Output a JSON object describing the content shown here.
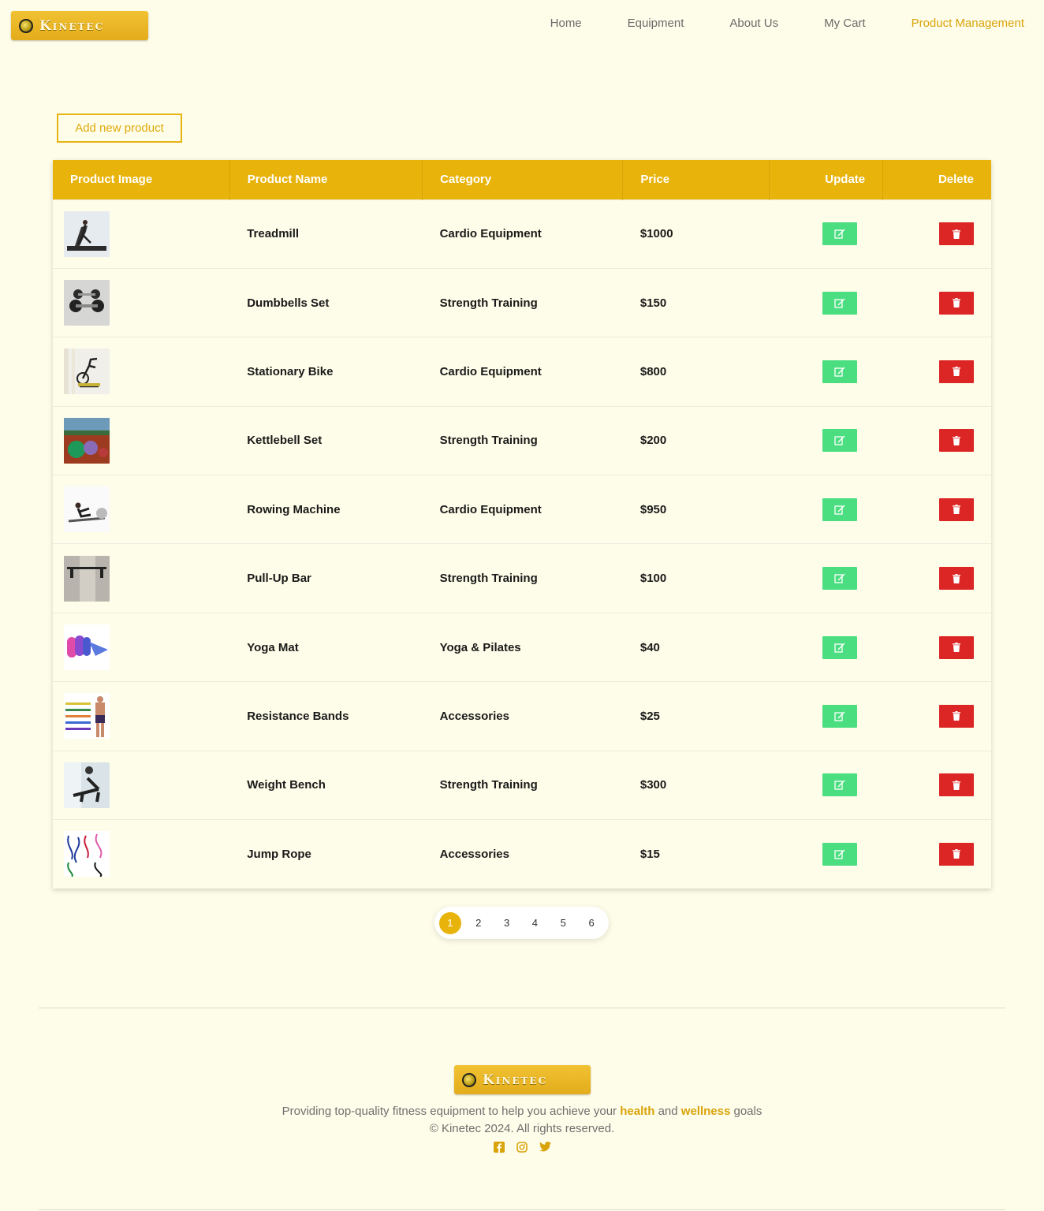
{
  "header": {
    "logo_text": "Kinetec",
    "nav": [
      {
        "label": "Home",
        "active": false
      },
      {
        "label": "Equipment",
        "active": false
      },
      {
        "label": "About Us",
        "active": false
      },
      {
        "label": "My Cart",
        "active": false
      },
      {
        "label": "Product Management",
        "active": true
      }
    ]
  },
  "add_button_label": "Add new product",
  "table": {
    "columns": [
      "Product Image",
      "Product Name",
      "Category",
      "Price",
      "Update",
      "Delete"
    ],
    "rows": [
      {
        "name": "Treadmill",
        "category": "Cardio Equipment",
        "price": "$1000",
        "image": "treadmill-photo"
      },
      {
        "name": "Dumbbells Set",
        "category": "Strength Training",
        "price": "$150",
        "image": "dumbbells-photo"
      },
      {
        "name": "Stationary Bike",
        "category": "Cardio Equipment",
        "price": "$800",
        "image": "bike-photo"
      },
      {
        "name": "Kettlebell Set",
        "category": "Strength Training",
        "price": "$200",
        "image": "kettlebell-photo"
      },
      {
        "name": "Rowing Machine",
        "category": "Cardio Equipment",
        "price": "$950",
        "image": "rowing-photo"
      },
      {
        "name": "Pull-Up Bar",
        "category": "Strength Training",
        "price": "$100",
        "image": "pullup-photo"
      },
      {
        "name": "Yoga Mat",
        "category": "Yoga & Pilates",
        "price": "$40",
        "image": "yogamat-photo"
      },
      {
        "name": "Resistance Bands",
        "category": "Accessories",
        "price": "$25",
        "image": "bands-photo"
      },
      {
        "name": "Weight Bench",
        "category": "Strength Training",
        "price": "$300",
        "image": "bench-photo"
      },
      {
        "name": "Jump Rope",
        "category": "Accessories",
        "price": "$15",
        "image": "jumprope-photo"
      }
    ]
  },
  "pagination": {
    "pages": [
      "1",
      "2",
      "3",
      "4",
      "5",
      "6"
    ],
    "current": "1"
  },
  "footer": {
    "logo_text": "Kinetec",
    "tagline_before": "Providing top-quality fitness equipment to help you achieve your ",
    "tagline_word1": "health",
    "tagline_mid": " and ",
    "tagline_word2": "wellness",
    "tagline_after": " goals",
    "copyright": "© Kinetec 2024. All rights reserved.",
    "social_icons": [
      "facebook-icon",
      "instagram-icon",
      "twitter-icon"
    ]
  },
  "colors": {
    "background": "#fefde9",
    "accent": "#e8b30b",
    "update": "#4ade80",
    "delete": "#dc2626"
  }
}
